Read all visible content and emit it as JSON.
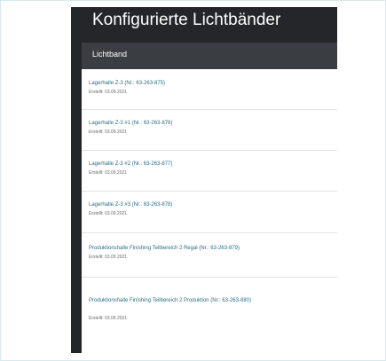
{
  "page_title": "Konfigurierte Lichtbänder",
  "table": {
    "column_header": "Lichtband",
    "rows": [
      {
        "name": "Lagerhalle Z-3 (Nr.: 63-263-875)",
        "date": "Erstellt: 03.09.2021"
      },
      {
        "name": "Lagerhalle Z-3 #1 (Nr.: 63-263-876)",
        "date": "Erstellt: 03.09.2021"
      },
      {
        "name": "Lagerhalle Z-3 #2 (Nr.: 63-263-877)",
        "date": "Erstellt: 03.09.2021"
      },
      {
        "name": "Lagerhalle Z-3 #3 (Nr.: 63-263-878)",
        "date": "Erstellt: 03.09.2021"
      },
      {
        "name": "Produktionshalle Finishing Teilbereich 2 Regal (Nr.: 63-263-879)",
        "date": "Erstellt: 03.09.2021"
      },
      {
        "name": "Produktionshalle Finishing Teilbereich 2 Produktion (Nr.: 63-263-880)",
        "date": "Erstellt: 03.09.2021"
      }
    ]
  }
}
